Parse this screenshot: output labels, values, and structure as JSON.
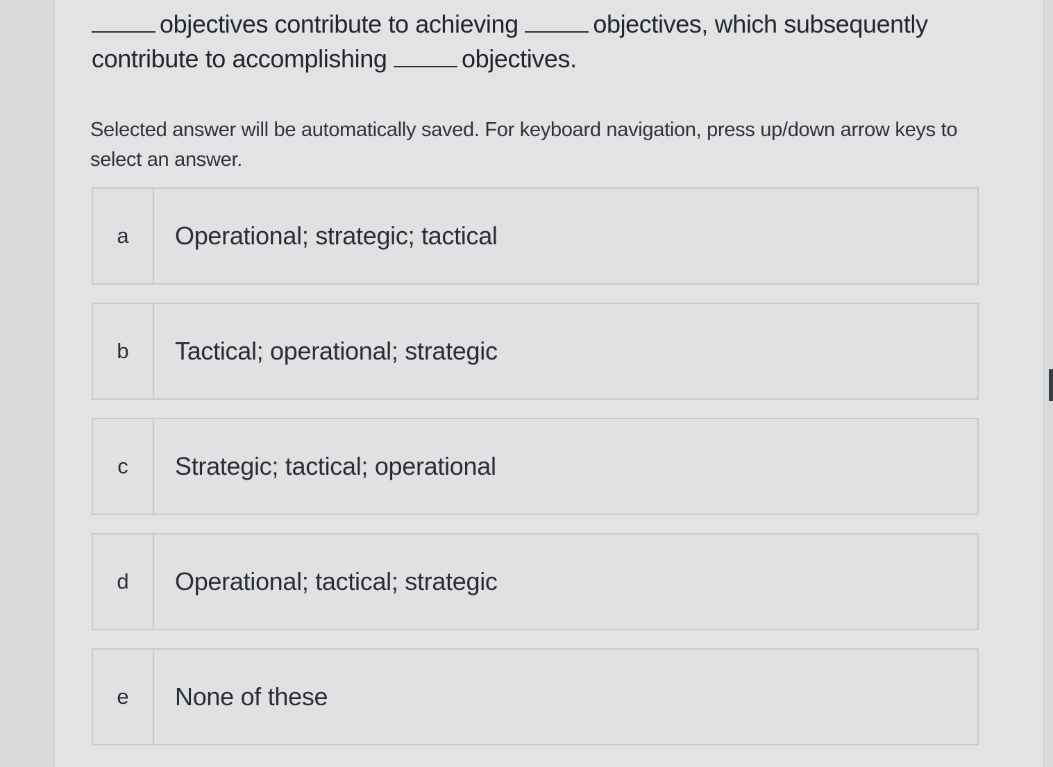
{
  "question": {
    "part1": "objectives contribute to achieving",
    "part2": "objectives, which subsequently contribute to accomplishing",
    "part3": "objectives."
  },
  "instructions": "Selected answer will be automatically saved. For keyboard navigation, press up/down arrow keys to select an answer.",
  "options": [
    {
      "key": "a",
      "label": "Operational; strategic; tactical"
    },
    {
      "key": "b",
      "label": "Tactical; operational; strategic"
    },
    {
      "key": "c",
      "label": "Strategic; tactical; operational"
    },
    {
      "key": "d",
      "label": "Operational; tactical; strategic"
    },
    {
      "key": "e",
      "label": "None of these"
    }
  ]
}
